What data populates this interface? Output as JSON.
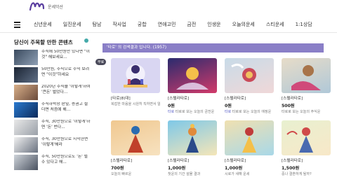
{
  "header": {
    "logo_text": "운세악산"
  },
  "nav": {
    "items": [
      "신년운세",
      "일진운세",
      "탐남",
      "작사업",
      "궁합",
      "연애고민",
      "금전",
      "인생운",
      "오늘의운세",
      "스티운세",
      "1:1상담"
    ]
  },
  "sidebar": {
    "title": "당신이 주목할 만한 콘텐츠",
    "news": [
      {
        "text": "주식에 50만원만 있다면 \"이것\" 해보세요..."
      },
      {
        "text": "50만원, 주식으로 수익 보려면 \"이것\"하세요"
      },
      {
        "text": "2020년 주식을 '이렇게'하여 '큰돈' 벌었다..."
      },
      {
        "text": "주식하락장 판잎, 증권고 설더면 처음에 해..."
      },
      {
        "text": "주식, 30만원으로 '이렇게'하면 '돈' 번다..."
      },
      {
        "text": "주식, 30만원으로 시작한면 '이렇게'해라"
      },
      {
        "text": "주식, 50만원으로도 '돈' 벌 수 있다고 해..."
      }
    ]
  },
  "main": {
    "search_text": "'타로' 의 검색결과 입니다.  (1957)",
    "cards": [
      {
        "label": "[타로(8)대]",
        "price": "",
        "desc": "복잡한 마음을 시원히 직하면서 알려주는 타로...",
        "free": "무료",
        "color1": "#d9d6f2",
        "color2": "#3a2e6e"
      },
      {
        "label": "[스텔라타로]",
        "price": "0원",
        "desc": "타로로 보는 오늘의 금전운",
        "link": "타로",
        "color1": "#2a2b6e",
        "color2": "#d23a6a"
      },
      {
        "label": "[스텔라타로]",
        "price": "0원",
        "desc": "타로로 보는 오늘의 애정운",
        "link": "타로",
        "color1": "#c8dbe8",
        "color2": "#c94a5a"
      },
      {
        "label": "[스텔라타로]",
        "price": "500원",
        "desc": "타로로 보는 오늘의 주식운",
        "link": "",
        "color1": "#e7dcc8",
        "color2": "#a8744a"
      },
      {
        "label": "[스텔라타로]",
        "price": "700원",
        "desc": "오늘의 빠르운",
        "link": "",
        "color1": "#f0c890",
        "color2": "#2a6bb0"
      },
      {
        "label": "[스텔라타로]",
        "price": "1,000원",
        "desc": "첫운의 기간 설물 결과",
        "link": "",
        "color1": "#7ec8e8",
        "color2": "#e08a3a"
      },
      {
        "label": "[스텔라타로]",
        "price": "1,000원",
        "desc": "시로가 새해 운세",
        "link": "",
        "color1": "#f0e0b0",
        "color2": "#c03a3a"
      },
      {
        "label": "[스텔라타로]",
        "price": "1,500원",
        "desc": "중나 결혼하게 될까?",
        "link": "",
        "color1": "#e8f0d0",
        "color2": "#d04a4a"
      }
    ]
  },
  "colors": {
    "accent": "#8a7fc7",
    "link": "#5a60c8"
  }
}
